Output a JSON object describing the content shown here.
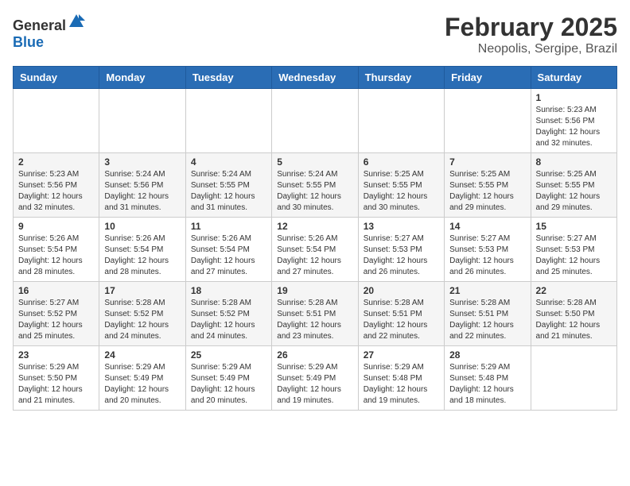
{
  "header": {
    "logo_general": "General",
    "logo_blue": "Blue",
    "month_title": "February 2025",
    "location": "Neopolis, Sergipe, Brazil"
  },
  "weekdays": [
    "Sunday",
    "Monday",
    "Tuesday",
    "Wednesday",
    "Thursday",
    "Friday",
    "Saturday"
  ],
  "weeks": [
    [
      {
        "day": "",
        "info": ""
      },
      {
        "day": "",
        "info": ""
      },
      {
        "day": "",
        "info": ""
      },
      {
        "day": "",
        "info": ""
      },
      {
        "day": "",
        "info": ""
      },
      {
        "day": "",
        "info": ""
      },
      {
        "day": "1",
        "info": "Sunrise: 5:23 AM\nSunset: 5:56 PM\nDaylight: 12 hours and 32 minutes."
      }
    ],
    [
      {
        "day": "2",
        "info": "Sunrise: 5:23 AM\nSunset: 5:56 PM\nDaylight: 12 hours and 32 minutes."
      },
      {
        "day": "3",
        "info": "Sunrise: 5:24 AM\nSunset: 5:56 PM\nDaylight: 12 hours and 31 minutes."
      },
      {
        "day": "4",
        "info": "Sunrise: 5:24 AM\nSunset: 5:55 PM\nDaylight: 12 hours and 31 minutes."
      },
      {
        "day": "5",
        "info": "Sunrise: 5:24 AM\nSunset: 5:55 PM\nDaylight: 12 hours and 30 minutes."
      },
      {
        "day": "6",
        "info": "Sunrise: 5:25 AM\nSunset: 5:55 PM\nDaylight: 12 hours and 30 minutes."
      },
      {
        "day": "7",
        "info": "Sunrise: 5:25 AM\nSunset: 5:55 PM\nDaylight: 12 hours and 29 minutes."
      },
      {
        "day": "8",
        "info": "Sunrise: 5:25 AM\nSunset: 5:55 PM\nDaylight: 12 hours and 29 minutes."
      }
    ],
    [
      {
        "day": "9",
        "info": "Sunrise: 5:26 AM\nSunset: 5:54 PM\nDaylight: 12 hours and 28 minutes."
      },
      {
        "day": "10",
        "info": "Sunrise: 5:26 AM\nSunset: 5:54 PM\nDaylight: 12 hours and 28 minutes."
      },
      {
        "day": "11",
        "info": "Sunrise: 5:26 AM\nSunset: 5:54 PM\nDaylight: 12 hours and 27 minutes."
      },
      {
        "day": "12",
        "info": "Sunrise: 5:26 AM\nSunset: 5:54 PM\nDaylight: 12 hours and 27 minutes."
      },
      {
        "day": "13",
        "info": "Sunrise: 5:27 AM\nSunset: 5:53 PM\nDaylight: 12 hours and 26 minutes."
      },
      {
        "day": "14",
        "info": "Sunrise: 5:27 AM\nSunset: 5:53 PM\nDaylight: 12 hours and 26 minutes."
      },
      {
        "day": "15",
        "info": "Sunrise: 5:27 AM\nSunset: 5:53 PM\nDaylight: 12 hours and 25 minutes."
      }
    ],
    [
      {
        "day": "16",
        "info": "Sunrise: 5:27 AM\nSunset: 5:52 PM\nDaylight: 12 hours and 25 minutes."
      },
      {
        "day": "17",
        "info": "Sunrise: 5:28 AM\nSunset: 5:52 PM\nDaylight: 12 hours and 24 minutes."
      },
      {
        "day": "18",
        "info": "Sunrise: 5:28 AM\nSunset: 5:52 PM\nDaylight: 12 hours and 24 minutes."
      },
      {
        "day": "19",
        "info": "Sunrise: 5:28 AM\nSunset: 5:51 PM\nDaylight: 12 hours and 23 minutes."
      },
      {
        "day": "20",
        "info": "Sunrise: 5:28 AM\nSunset: 5:51 PM\nDaylight: 12 hours and 22 minutes."
      },
      {
        "day": "21",
        "info": "Sunrise: 5:28 AM\nSunset: 5:51 PM\nDaylight: 12 hours and 22 minutes."
      },
      {
        "day": "22",
        "info": "Sunrise: 5:28 AM\nSunset: 5:50 PM\nDaylight: 12 hours and 21 minutes."
      }
    ],
    [
      {
        "day": "23",
        "info": "Sunrise: 5:29 AM\nSunset: 5:50 PM\nDaylight: 12 hours and 21 minutes."
      },
      {
        "day": "24",
        "info": "Sunrise: 5:29 AM\nSunset: 5:49 PM\nDaylight: 12 hours and 20 minutes."
      },
      {
        "day": "25",
        "info": "Sunrise: 5:29 AM\nSunset: 5:49 PM\nDaylight: 12 hours and 20 minutes."
      },
      {
        "day": "26",
        "info": "Sunrise: 5:29 AM\nSunset: 5:49 PM\nDaylight: 12 hours and 19 minutes."
      },
      {
        "day": "27",
        "info": "Sunrise: 5:29 AM\nSunset: 5:48 PM\nDaylight: 12 hours and 19 minutes."
      },
      {
        "day": "28",
        "info": "Sunrise: 5:29 AM\nSunset: 5:48 PM\nDaylight: 12 hours and 18 minutes."
      },
      {
        "day": "",
        "info": ""
      }
    ]
  ]
}
